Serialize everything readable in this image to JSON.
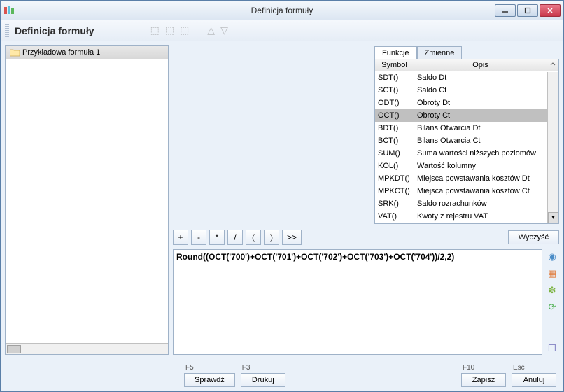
{
  "window": {
    "title": "Definicja formuły"
  },
  "section_title": "Definicja formuły",
  "tree": {
    "items": [
      {
        "label": "Przykładowa formuła 1"
      }
    ]
  },
  "tabs": {
    "functions": "Funkcje",
    "variables": "Zmienne",
    "active": "Funkcje"
  },
  "grid": {
    "headers": {
      "symbol": "Symbol",
      "desc": "Opis"
    },
    "rows": [
      {
        "symbol": "SDT()",
        "desc": "Saldo Dt"
      },
      {
        "symbol": "SCT()",
        "desc": "Saldo Ct"
      },
      {
        "symbol": "ODT()",
        "desc": "Obroty Dt"
      },
      {
        "symbol": "OCT()",
        "desc": "Obroty Ct",
        "selected": true
      },
      {
        "symbol": "BDT()",
        "desc": "Bilans Otwarcia Dt"
      },
      {
        "symbol": "BCT()",
        "desc": "Bilans Otwarcia Ct"
      },
      {
        "symbol": "SUM()",
        "desc": "Suma wartości niższych poziomów"
      },
      {
        "symbol": "KOL()",
        "desc": "Wartość kolumny"
      },
      {
        "symbol": "MPKDT()",
        "desc": "Miejsca powstawania kosztów Dt"
      },
      {
        "symbol": "MPKCT()",
        "desc": "Miejsca powstawania kosztów Ct"
      },
      {
        "symbol": "SRK()",
        "desc": "Saldo rozrachunków"
      },
      {
        "symbol": "VAT()",
        "desc": "Kwoty z rejestru VAT"
      }
    ]
  },
  "operators": {
    "buttons": [
      "+",
      "-",
      "*",
      "/",
      "(",
      ")",
      ">>"
    ],
    "clear": "Wyczyść"
  },
  "formula": "Round((OCT('700')+OCT('701')+OCT('702')+OCT('703')+OCT('704'))/2,2)",
  "footer": {
    "check_key": "F5",
    "check": "Sprawdź",
    "print_key": "F3",
    "print": "Drukuj",
    "save_key": "F10",
    "save": "Zapisz",
    "cancel_key": "Esc",
    "cancel": "Anuluj"
  }
}
